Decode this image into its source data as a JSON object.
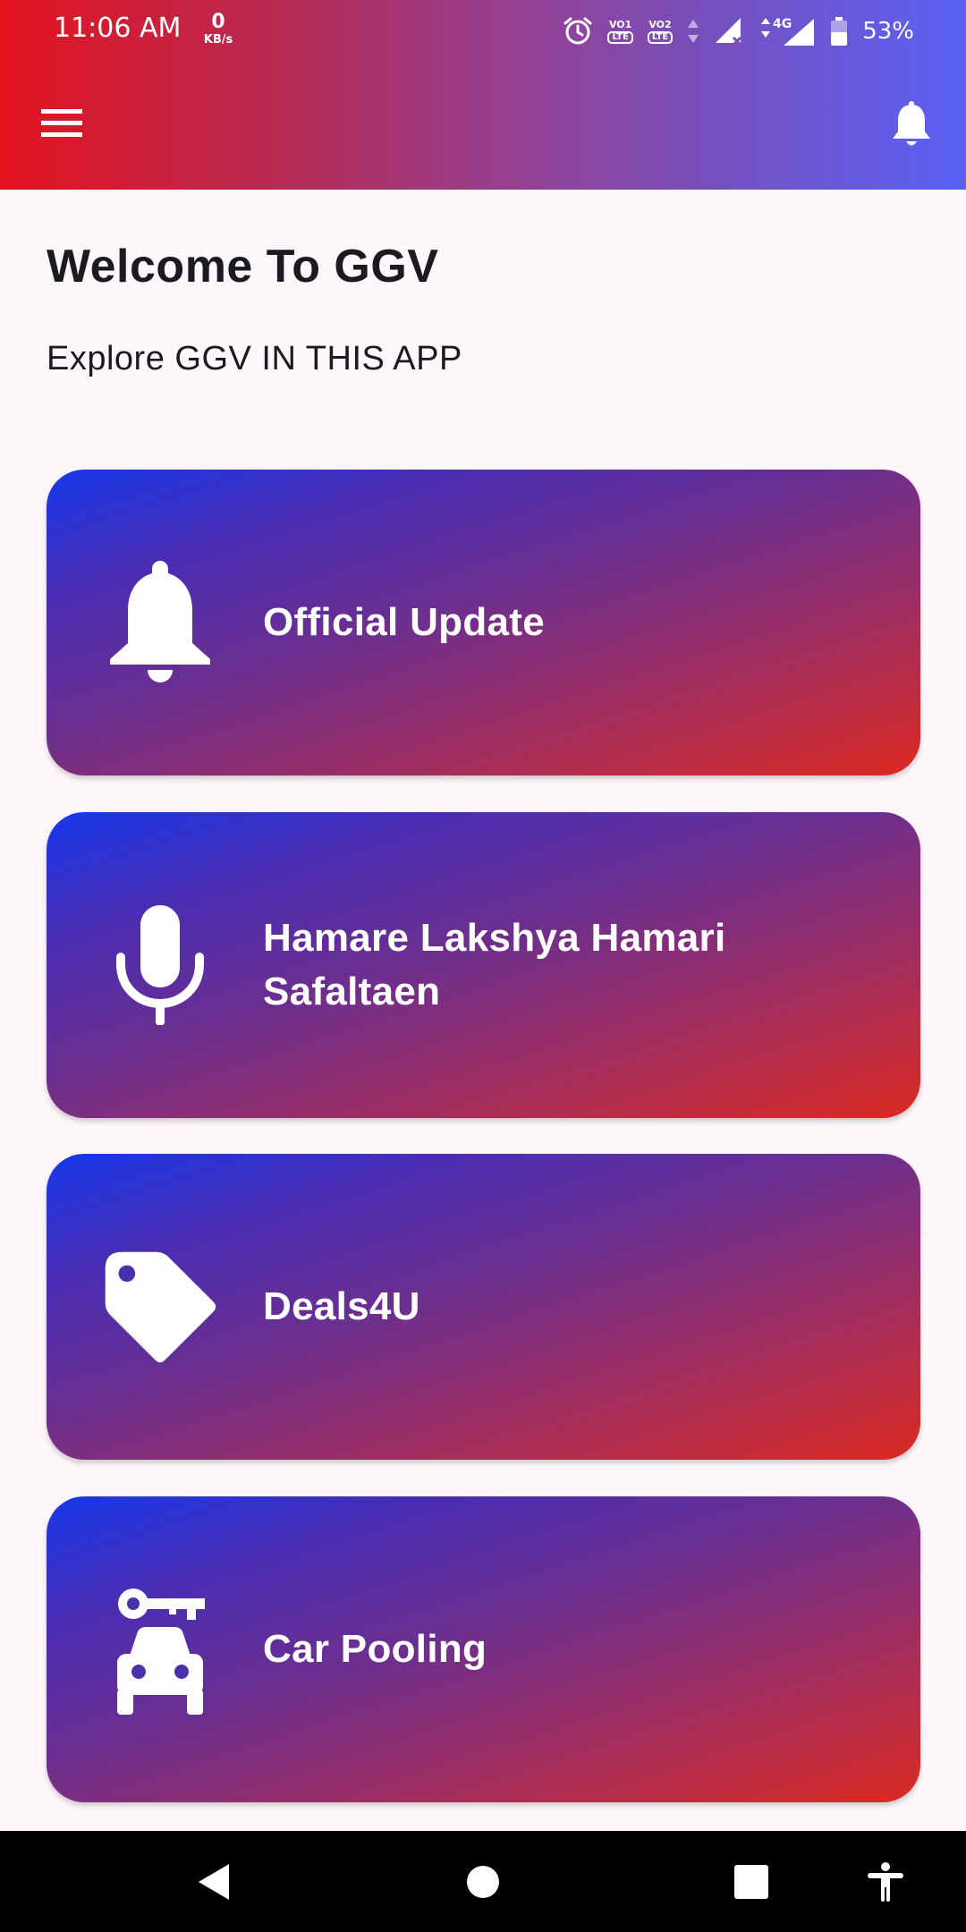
{
  "status_bar": {
    "time": "11:06 AM",
    "net_speed_value": "0",
    "net_speed_unit": "KB/s",
    "sim1_label": "VO1",
    "sim2_label": "VO2",
    "lte_label": "LTE",
    "network_type": "4G",
    "battery_percent": "53%"
  },
  "header": {
    "menu_icon": "hamburger-menu-icon",
    "notification_icon": "bell-icon",
    "gradient_start": "#e3141f",
    "gradient_end": "#5a61f5"
  },
  "welcome": {
    "title": "Welcome To GGV",
    "subtitle": "Explore GGV IN THIS APP"
  },
  "cards": [
    {
      "label": "Official Update",
      "icon": "bell-icon"
    },
    {
      "label": "Hamare Lakshya Hamari Safaltaen",
      "icon": "microphone-icon"
    },
    {
      "label": "Deals4U",
      "icon": "tag-icon"
    },
    {
      "label": "Car Pooling",
      "icon": "car-key-icon"
    }
  ],
  "card_colors": {
    "start": "#1638ea",
    "end": "#dd2a20"
  },
  "nav_bar": {
    "back_icon": "back-triangle-icon",
    "home_icon": "home-circle-icon",
    "recents_icon": "recents-square-icon",
    "accessibility_icon": "accessibility-icon"
  }
}
